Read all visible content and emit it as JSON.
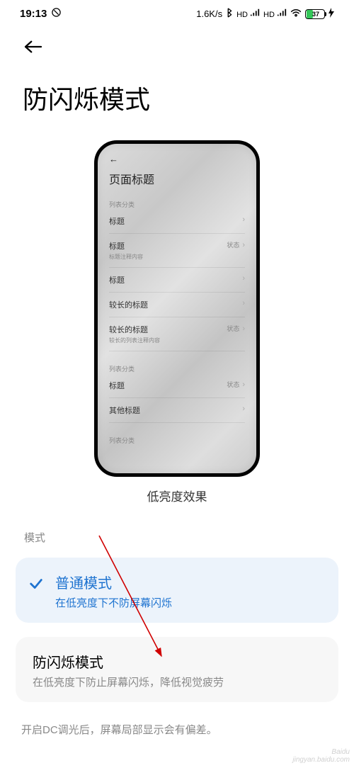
{
  "status": {
    "time": "19:13",
    "speed": "1.6K/s",
    "battery_pct": "37"
  },
  "page": {
    "title": "防闪烁模式",
    "caption": "低亮度效果",
    "section_label": "模式",
    "footer_note": "开启DC调光后，屏幕局部显示会有偏差。"
  },
  "preview": {
    "page_title": "页面标题",
    "sections": {
      "s1": "列表分类",
      "s2": "列表分类",
      "s3": "列表分类"
    },
    "rows": {
      "r1": {
        "title": "标题",
        "status": ""
      },
      "r2": {
        "title": "标题",
        "sub": "标题注释内容",
        "status": "状态"
      },
      "r3": {
        "title": "标题",
        "status": ""
      },
      "r4": {
        "title": "较长的标题",
        "status": ""
      },
      "r5": {
        "title": "较长的标题",
        "sub": "较长的列表注释内容",
        "status": "状态"
      },
      "r6": {
        "title": "标题",
        "status": "状态"
      },
      "r7": {
        "title": "其他标题",
        "status": ""
      }
    }
  },
  "modes": {
    "normal": {
      "title": "普通模式",
      "desc": "在低亮度下不防屏幕闪烁"
    },
    "antiflicker": {
      "title": "防闪烁模式",
      "desc": "在低亮度下防止屏幕闪烁，降低视觉疲劳"
    }
  }
}
